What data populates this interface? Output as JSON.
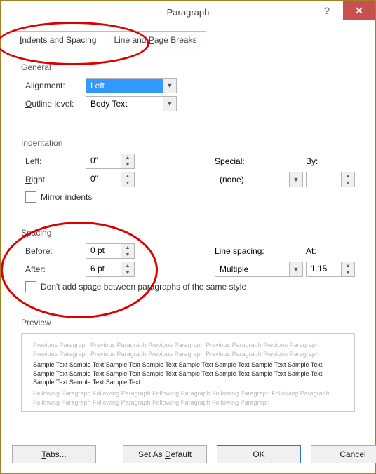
{
  "window": {
    "title": "Paragraph",
    "help_glyph": "?",
    "close_glyph": "✕"
  },
  "tabs": {
    "active": "Indents and Spacing",
    "inactive": "Line and Page Breaks"
  },
  "general": {
    "title": "General",
    "alignment_label": "Alignment:",
    "alignment_value": "Left",
    "outline_label": "Outline level:",
    "outline_value": "Body Text"
  },
  "indentation": {
    "title": "Indentation",
    "left_label": "Left:",
    "left_value": "0\"",
    "right_label": "Right:",
    "right_value": "0\"",
    "special_label": "Special:",
    "special_value": "(none)",
    "by_label": "By:",
    "by_value": "",
    "mirror_label": "Mirror indents"
  },
  "spacing": {
    "title": "Spacing",
    "before_label": "Before:",
    "before_value": "0 pt",
    "after_label": "After:",
    "after_value": "6 pt",
    "line_label": "Line spacing:",
    "line_value": "Multiple",
    "at_label": "At:",
    "at_value": "1.15",
    "nospace_label": "Don't add space between paragraphs of the same style"
  },
  "preview": {
    "title": "Preview",
    "ghost_prev": "Previous Paragraph Previous Paragraph Previous Paragraph Previous Paragraph Previous Paragraph Previous Paragraph Previous Paragraph Previous Paragraph Previous Paragraph Previous Paragraph",
    "sample": "Sample Text Sample Text Sample Text Sample Text Sample Text Sample Text Sample Text Sample Text Sample Text Sample Text Sample Text Sample Text Sample Text Sample Text Sample Text Sample Text Sample Text Sample Text Sample Text",
    "ghost_next": "Following Paragraph Following Paragraph Following Paragraph Following Paragraph Following Paragraph Following Paragraph Following Paragraph Following Paragraph Following Paragraph"
  },
  "footer": {
    "tabs_btn": "Tabs...",
    "default_btn": "Set As Default",
    "ok_btn": "OK",
    "cancel_btn": "Cancel"
  }
}
